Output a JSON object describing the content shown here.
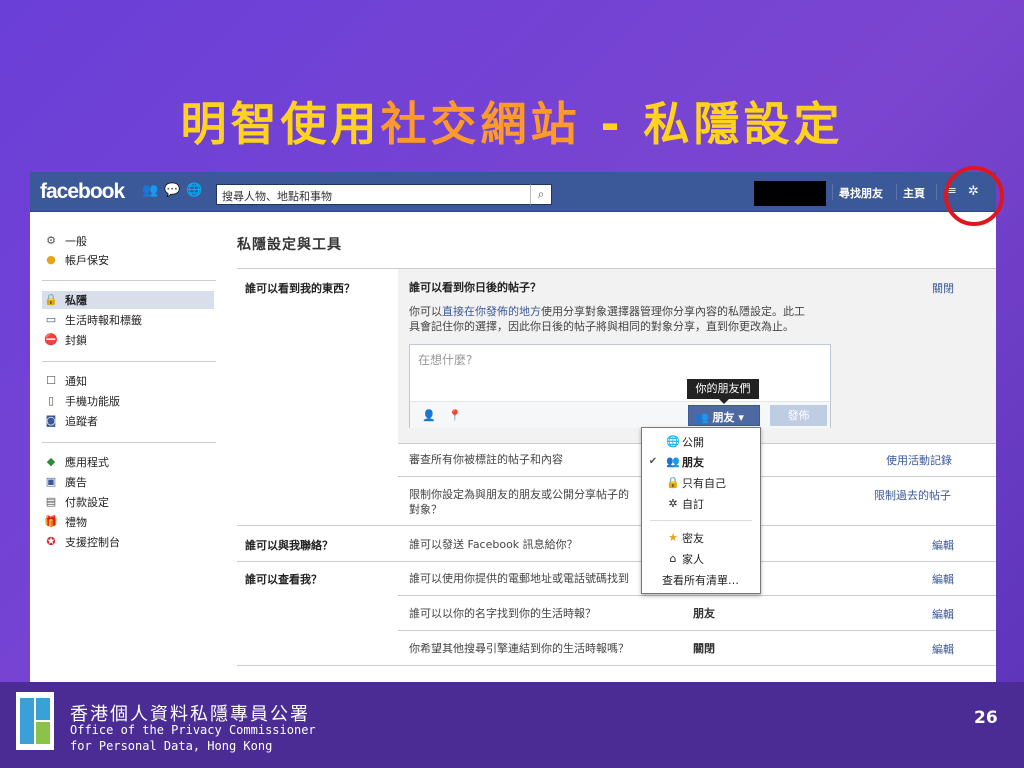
{
  "slide": {
    "title_part1": "明智使用",
    "title_part2": "社交網站",
    "title_part3": " - 私隱設定",
    "page_number": "26",
    "org_zh": "香港個人資料私隱專員公署",
    "org_en_line1": "Office of the Privacy Commissioner",
    "org_en_line2": "for Personal Data, Hong Kong"
  },
  "topbar": {
    "logo": "facebook",
    "search_placeholder": "搜尋人物、地點和事物",
    "find_friends": "尋找朋友",
    "home": "主頁"
  },
  "sidebar": {
    "items": [
      {
        "label": "一般",
        "icon": "gears-icon"
      },
      {
        "label": "帳戶保安",
        "icon": "badge-icon"
      },
      {
        "label": "私隱",
        "icon": "lock-icon"
      },
      {
        "label": "生活時報和標籤",
        "icon": "timeline-icon"
      },
      {
        "label": "封鎖",
        "icon": "block-icon"
      },
      {
        "label": "通知",
        "icon": "notification-icon"
      },
      {
        "label": "手機功能版",
        "icon": "mobile-icon"
      },
      {
        "label": "追蹤者",
        "icon": "rss-icon"
      },
      {
        "label": "應用程式",
        "icon": "apps-icon"
      },
      {
        "label": "廣告",
        "icon": "ads-icon"
      },
      {
        "label": "付款設定",
        "icon": "card-icon"
      },
      {
        "label": "禮物",
        "icon": "gift-icon"
      },
      {
        "label": "支援控制台",
        "icon": "support-icon"
      }
    ]
  },
  "main": {
    "title": "私隱設定與工具",
    "section1": {
      "label": "誰可以看到我的東西？",
      "expanded_title": "誰可以看到你日後的帖子？",
      "close": "關閉",
      "desc_pre": "你可以",
      "desc_link": "直接在你發佈的地方",
      "desc_post": "使用分享對象選擇器管理你分享內容的私隱設定。此工",
      "desc_line2": "具會記住你的選擇，因此你日後的帖子將與相同的對象分享，直到你更改為止。",
      "composer_placeholder": "在想什麼?",
      "tooltip": "你的朋友們",
      "audience_button": "朋友",
      "post_button": "發佈",
      "row2_text": "審查所有你被標註的帖子和內容",
      "row2_link": "使用活動記錄",
      "row3_text_line1": "限制你設定為與朋友的朋友或公開分享帖子的",
      "row3_text_line2": "對象？",
      "row3_link": "限制過去的帖子"
    },
    "section2": {
      "label": "誰可以與我聯絡？",
      "row_text": "誰可以發送 Facebook 訊息給你？",
      "link": "編輯"
    },
    "section3": {
      "label": "誰可以查看我？",
      "row1_text": "誰可以使用你提供的電郵地址或電話號碼找到",
      "row1_link": "編輯",
      "row2_text": "誰可以以你的名字找到你的生活時報？",
      "row2_value": "朋友",
      "row2_link": "編輯",
      "row3_text": "你希望其他搜尋引擎連結到你的生活時報嗎？",
      "row3_value": "關閉",
      "row3_link": "編輯"
    }
  },
  "dropdown": {
    "items": [
      {
        "label": "公開",
        "icon": "globe-icon",
        "checked": false
      },
      {
        "label": "朋友",
        "icon": "friends-icon",
        "checked": true
      },
      {
        "label": "只有自己",
        "icon": "lock-icon",
        "checked": false
      },
      {
        "label": "自訂",
        "icon": "gear-icon",
        "checked": false
      },
      {
        "label": "密友",
        "icon": "star-icon",
        "checked": false
      },
      {
        "label": "家人",
        "icon": "home-icon",
        "checked": false
      }
    ],
    "see_all": "查看所有清單…"
  },
  "colors": {
    "facebook_blue": "#3b5998",
    "highlight_red": "#e0161e",
    "title_yellow": "#ffd21f",
    "title_orange": "#ff9a2a"
  }
}
